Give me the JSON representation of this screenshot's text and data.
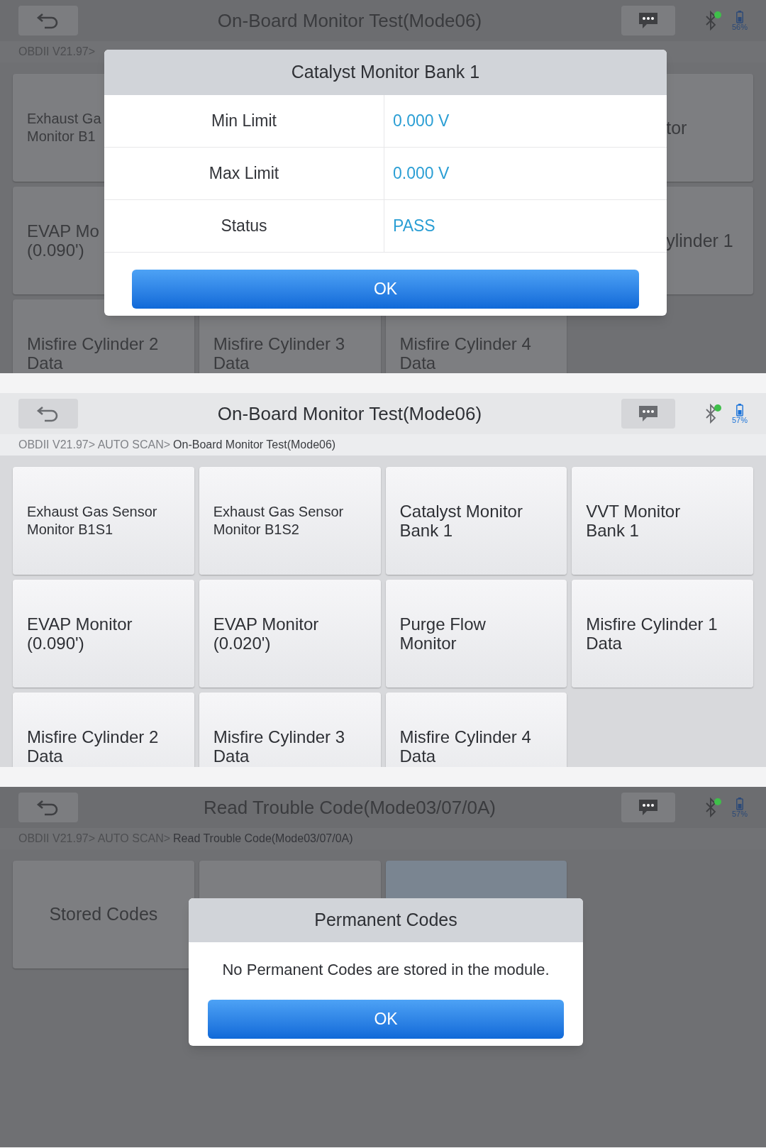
{
  "panels": [
    {
      "dimmed": true,
      "title": "On-Board Monitor Test(Mode06)",
      "battery": "56%",
      "breadcrumb": {
        "path": "OBDII V21.97>"
      },
      "tiles": [
        {
          "kind": "small",
          "label": "Exhaust Ga\nMonitor B1"
        },
        {
          "kind": "blank"
        },
        {
          "kind": "blank"
        },
        {
          "kind": "tail",
          "label": "tor"
        },
        {
          "kind": "large",
          "label": "EVAP Mo\n(0.090')"
        },
        {
          "kind": "blank"
        },
        {
          "kind": "blank"
        },
        {
          "kind": "tail",
          "label": "ylinder 1"
        },
        {
          "kind": "large",
          "label": "Misfire Cylinder 2\nData"
        },
        {
          "kind": "large",
          "label": "Misfire Cylinder 3\nData"
        },
        {
          "kind": "large",
          "label": "Misfire Cylinder 4\nData"
        }
      ],
      "dialog": {
        "kind": "table",
        "title": "Catalyst Monitor Bank 1",
        "rows": [
          {
            "label": "Min Limit",
            "value": "0.000 V"
          },
          {
            "label": "Max Limit",
            "value": "0.000 V"
          },
          {
            "label": "Status",
            "value": "PASS"
          }
        ],
        "button": "OK"
      }
    },
    {
      "dimmed": false,
      "title": "On-Board Monitor Test(Mode06)",
      "battery": "57%",
      "breadcrumb": {
        "path": "OBDII V21.97> AUTO SCAN>",
        "current": "On-Board Monitor Test(Mode06)"
      },
      "tiles": [
        {
          "kind": "small",
          "label": "Exhaust Gas Sensor Monitor B1S1",
          "selected": false
        },
        {
          "kind": "small",
          "label": "Exhaust Gas Sensor Monitor B1S2",
          "selected": false
        },
        {
          "kind": "large",
          "label": "Catalyst Monitor Bank 1",
          "selected": false
        },
        {
          "kind": "large",
          "label": "VVT Monitor Bank 1",
          "selected": false
        },
        {
          "kind": "large",
          "label": "EVAP Monitor (0.090')",
          "selected": false
        },
        {
          "kind": "large",
          "label": "EVAP Monitor (0.020')",
          "selected": false
        },
        {
          "kind": "large",
          "label": "Purge Flow Monitor",
          "selected": false
        },
        {
          "kind": "large",
          "label": "Misfire Cylinder 1 Data",
          "selected": false
        },
        {
          "kind": "large",
          "label": "Misfire Cylinder 2 Data",
          "selected": false
        },
        {
          "kind": "large",
          "label": "Misfire Cylinder 3 Data",
          "selected": false
        },
        {
          "kind": "large",
          "label": "Misfire Cylinder 4 Data",
          "selected": false
        }
      ]
    },
    {
      "dimmed": true,
      "title": "Read Trouble Code(Mode03/07/0A)",
      "battery": "57%",
      "breadcrumb": {
        "path": "OBDII V21.97> AUTO SCAN>",
        "current": "Read Trouble Code(Mode03/07/0A)"
      },
      "tiles": [
        {
          "kind": "center",
          "label": "Stored Codes",
          "selected": false
        },
        {
          "kind": "blank",
          "selected": false
        },
        {
          "kind": "blank",
          "selected": true
        }
      ],
      "dialog": {
        "kind": "message",
        "title": "Permanent Codes",
        "message": "No Permanent Codes are stored in the module.",
        "button": "OK"
      }
    }
  ]
}
